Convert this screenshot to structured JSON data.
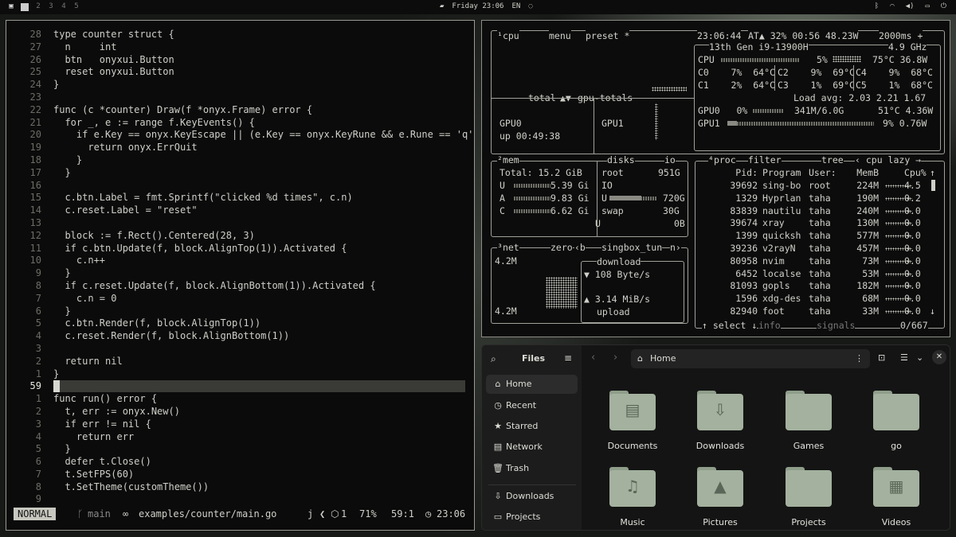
{
  "topbar": {
    "workspaces": [
      "2",
      "3",
      "4",
      "5"
    ],
    "datetime": "Friday 23:06",
    "lang": "EN"
  },
  "editor": {
    "lines": [
      {
        "n": "28",
        "t": "type counter struct {"
      },
      {
        "n": "27",
        "t": "  n     int"
      },
      {
        "n": "26",
        "t": "  btn   onyxui.Button"
      },
      {
        "n": "25",
        "t": "  reset onyxui.Button"
      },
      {
        "n": "24",
        "t": "}"
      },
      {
        "n": "23",
        "t": ""
      },
      {
        "n": "22",
        "t": "func (c *counter) Draw(f *onyx.Frame) error {"
      },
      {
        "n": "21",
        "t": "  for _, e := range f.KeyEvents() {"
      },
      {
        "n": "20",
        "t": "    if e.Key == onyx.KeyEscape || (e.Key == onyx.KeyRune && e.Rune == 'q'"
      },
      {
        "n": "19",
        "t": "      return onyx.ErrQuit"
      },
      {
        "n": "18",
        "t": "    }"
      },
      {
        "n": "17",
        "t": "  }"
      },
      {
        "n": "16",
        "t": ""
      },
      {
        "n": "15",
        "t": "  c.btn.Label = fmt.Sprintf(\"clicked %d times\", c.n)"
      },
      {
        "n": "14",
        "t": "  c.reset.Label = \"reset\""
      },
      {
        "n": "13",
        "t": ""
      },
      {
        "n": "12",
        "t": "  block := f.Rect().Centered(28, 3)"
      },
      {
        "n": "11",
        "t": "  if c.btn.Update(f, block.AlignTop(1)).Activated {"
      },
      {
        "n": "10",
        "t": "    c.n++"
      },
      {
        "n": "9",
        "t": "  }"
      },
      {
        "n": "8",
        "t": "  if c.reset.Update(f, block.AlignBottom(1)).Activated {"
      },
      {
        "n": "7",
        "t": "    c.n = 0"
      },
      {
        "n": "6",
        "t": "  }"
      },
      {
        "n": "5",
        "t": "  c.btn.Render(f, block.AlignTop(1))"
      },
      {
        "n": "4",
        "t": "  c.reset.Render(f, block.AlignBottom(1))"
      },
      {
        "n": "3",
        "t": ""
      },
      {
        "n": "2",
        "t": "  return nil"
      },
      {
        "n": "1",
        "t": "}"
      },
      {
        "n": "59",
        "t": ""
      },
      {
        "n": "1",
        "t": "func run() error {"
      },
      {
        "n": "2",
        "t": "  t, err := onyx.New()"
      },
      {
        "n": "3",
        "t": "  if err != nil {"
      },
      {
        "n": "4",
        "t": "    return err"
      },
      {
        "n": "5",
        "t": "  }"
      },
      {
        "n": "6",
        "t": "  defer t.Close()"
      },
      {
        "n": "7",
        "t": "  t.SetFPS(60)"
      },
      {
        "n": "8",
        "t": "  t.SetTheme(customTheme())"
      },
      {
        "n": "9",
        "t": ""
      }
    ],
    "status": {
      "mode": "NORMAL",
      "branch": "main",
      "path": "examples/counter/main.go",
      "lang": "j",
      "count": "1",
      "percent": "71%",
      "pos": "59:1",
      "time": "23:06"
    }
  },
  "btop": {
    "header": {
      "title": "cpu",
      "menu": "menu",
      "preset": "preset *",
      "time": "23:06:44",
      "bat": "AT▲ 32% 00:56 48.23W",
      "rate": "2000ms +"
    },
    "cpu": {
      "model": "13th Gen i9-13900H",
      "freq": "4.9 GHz",
      "total_label": "total",
      "gpu_totals": "gpu-totals",
      "cpu_line": "CPU",
      "cpu_pct": "5%",
      "cpu_temp": "75°C 36.8W",
      "c0": "C0    7%  64°C",
      "c2": "C2    9%  69°C",
      "c4": "C4    9%  68°C",
      "c1": "C1    2%  64°C",
      "c3": "C3    1%  69°C",
      "c5": "C5    1%  68°C",
      "load": "Load avg: 2.03 2.21 1.67",
      "gpu0": "GPU0   0%",
      "gpu0_mem": "341M/6.0G",
      "gpu0_stat": "51°C 4.36W",
      "gpu1": "GPU1",
      "gpu1_stat": "9% 0.76W",
      "gpu0_label": "GPU0",
      "uptime": "up 00:49:38",
      "gpu1_label": "GPU1"
    },
    "mem": {
      "title": "mem",
      "disks": "disks",
      "io": "io",
      "total": "Total: 15.2 GiB",
      "u": "U",
      "u_val": "5.39 Gi",
      "a": "A",
      "a_val": "9.83 Gi",
      "c": "C",
      "c_val": "6.62 Gi",
      "root": "root",
      "root_size": "951G",
      "io_label": "IO",
      "u2": "U",
      "root_used": "720G",
      "swap": "swap",
      "swap_size": "30G",
      "u3": "U",
      "swap_used": "0B"
    },
    "net": {
      "title": "net",
      "zero": "zero",
      "iface": "singbox_tun",
      "top": "4.2M",
      "bottom": "4.2M",
      "download": "download",
      "down_rate": "▼ 108 Byte/s",
      "up_rate": "▲ 3.14 MiB/s",
      "upload": "upload"
    },
    "proc": {
      "title": "proc",
      "filter": "filter",
      "tree": "tree",
      "sort": "cpu lazy",
      "headers": [
        "Pid:",
        "Program",
        "User:",
        "MemB",
        "Cpu%"
      ],
      "rows": [
        [
          "39692",
          "sing-bo",
          "root",
          "224M",
          "4.5"
        ],
        [
          "1329",
          "Hyprlan",
          "taha",
          "190M",
          "0.2"
        ],
        [
          "83839",
          "nautilu",
          "taha",
          "240M",
          "0.0"
        ],
        [
          "39674",
          "xray",
          "taha",
          "130M",
          "0.0"
        ],
        [
          "1399",
          "quicksh",
          "taha",
          "577M",
          "0.0"
        ],
        [
          "39236",
          "v2rayN",
          "taha",
          "457M",
          "0.0"
        ],
        [
          "80958",
          "nvim",
          "taha",
          "73M",
          "0.0"
        ],
        [
          "6452",
          "localse",
          "taha",
          "53M",
          "0.0"
        ],
        [
          "81093",
          "gopls",
          "taha",
          "182M",
          "0.0"
        ],
        [
          "1596",
          "xdg-des",
          "taha",
          "68M",
          "0.0"
        ],
        [
          "82940",
          "foot",
          "taha",
          "33M",
          "0.0"
        ]
      ],
      "select": "select",
      "info": "info",
      "signals": "signals",
      "count": "0/667"
    }
  },
  "files": {
    "title": "Files",
    "location": "Home",
    "sidebar": [
      {
        "icon": "⌂",
        "label": "Home"
      },
      {
        "icon": "◷",
        "label": "Recent"
      },
      {
        "icon": "★",
        "label": "Starred"
      },
      {
        "icon": "▤",
        "label": "Network"
      },
      {
        "icon": "🗑",
        "label": "Trash"
      },
      {
        "icon": "⇩",
        "label": "Downloads"
      },
      {
        "icon": "▭",
        "label": "Projects"
      }
    ],
    "folders": [
      {
        "label": "Documents",
        "glyph": "▤"
      },
      {
        "label": "Downloads",
        "glyph": "⇩"
      },
      {
        "label": "Games",
        "glyph": ""
      },
      {
        "label": "go",
        "glyph": ""
      },
      {
        "label": "Music",
        "glyph": "♫"
      },
      {
        "label": "Pictures",
        "glyph": "▲"
      },
      {
        "label": "Projects",
        "glyph": ""
      },
      {
        "label": "Videos",
        "glyph": "▦"
      }
    ]
  }
}
